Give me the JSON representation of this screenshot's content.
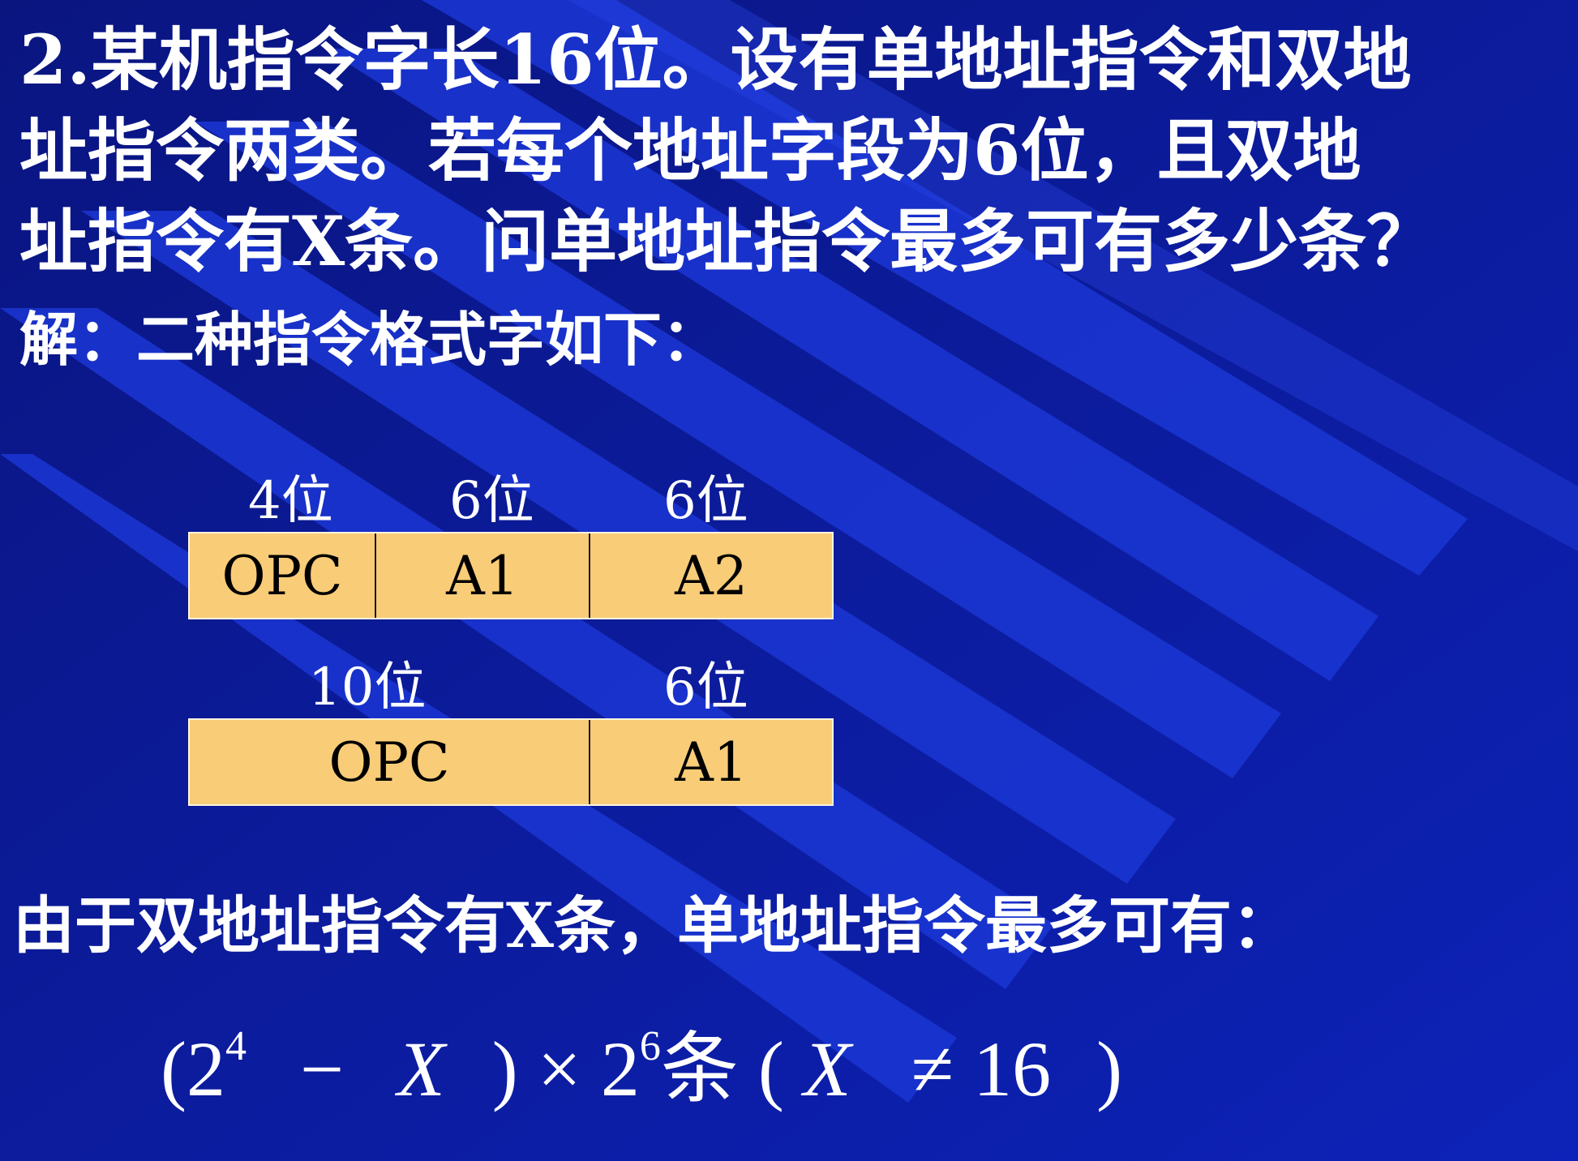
{
  "question": {
    "lines": [
      "2.某机指令字长16位。设有单地址指令和双地",
      "址指令两类。若每个地址字段为6位，且双地",
      "址指令有X条。问单地址指令最多可有多少条？"
    ]
  },
  "solution_intro": "解：二种指令格式字如下：",
  "format1": {
    "bit_labels": [
      "4位",
      "6位",
      "6位"
    ],
    "fields": [
      "OPC",
      "A1",
      "A2"
    ]
  },
  "format2": {
    "bit_labels": [
      "10位",
      "6位"
    ],
    "fields": [
      "OPC",
      "A1"
    ]
  },
  "conclusion": "由于双地址指令有X条，单地址指令最多可有：",
  "formula": {
    "open_paren": "(",
    "base1": "2",
    "exp1": "4",
    "minus": "−",
    "var1": "X",
    "close_paren": ")",
    "times": "×",
    "base2": "2",
    "exp2": "6",
    "unit": "条",
    "cond_open": "(",
    "var2": "X",
    "neq": "≠",
    "num": "16",
    "cond_close": ")"
  },
  "colors": {
    "background": "#0a1a9a",
    "stripe": "#1f3ce0",
    "box_fill": "#f9cc78"
  }
}
